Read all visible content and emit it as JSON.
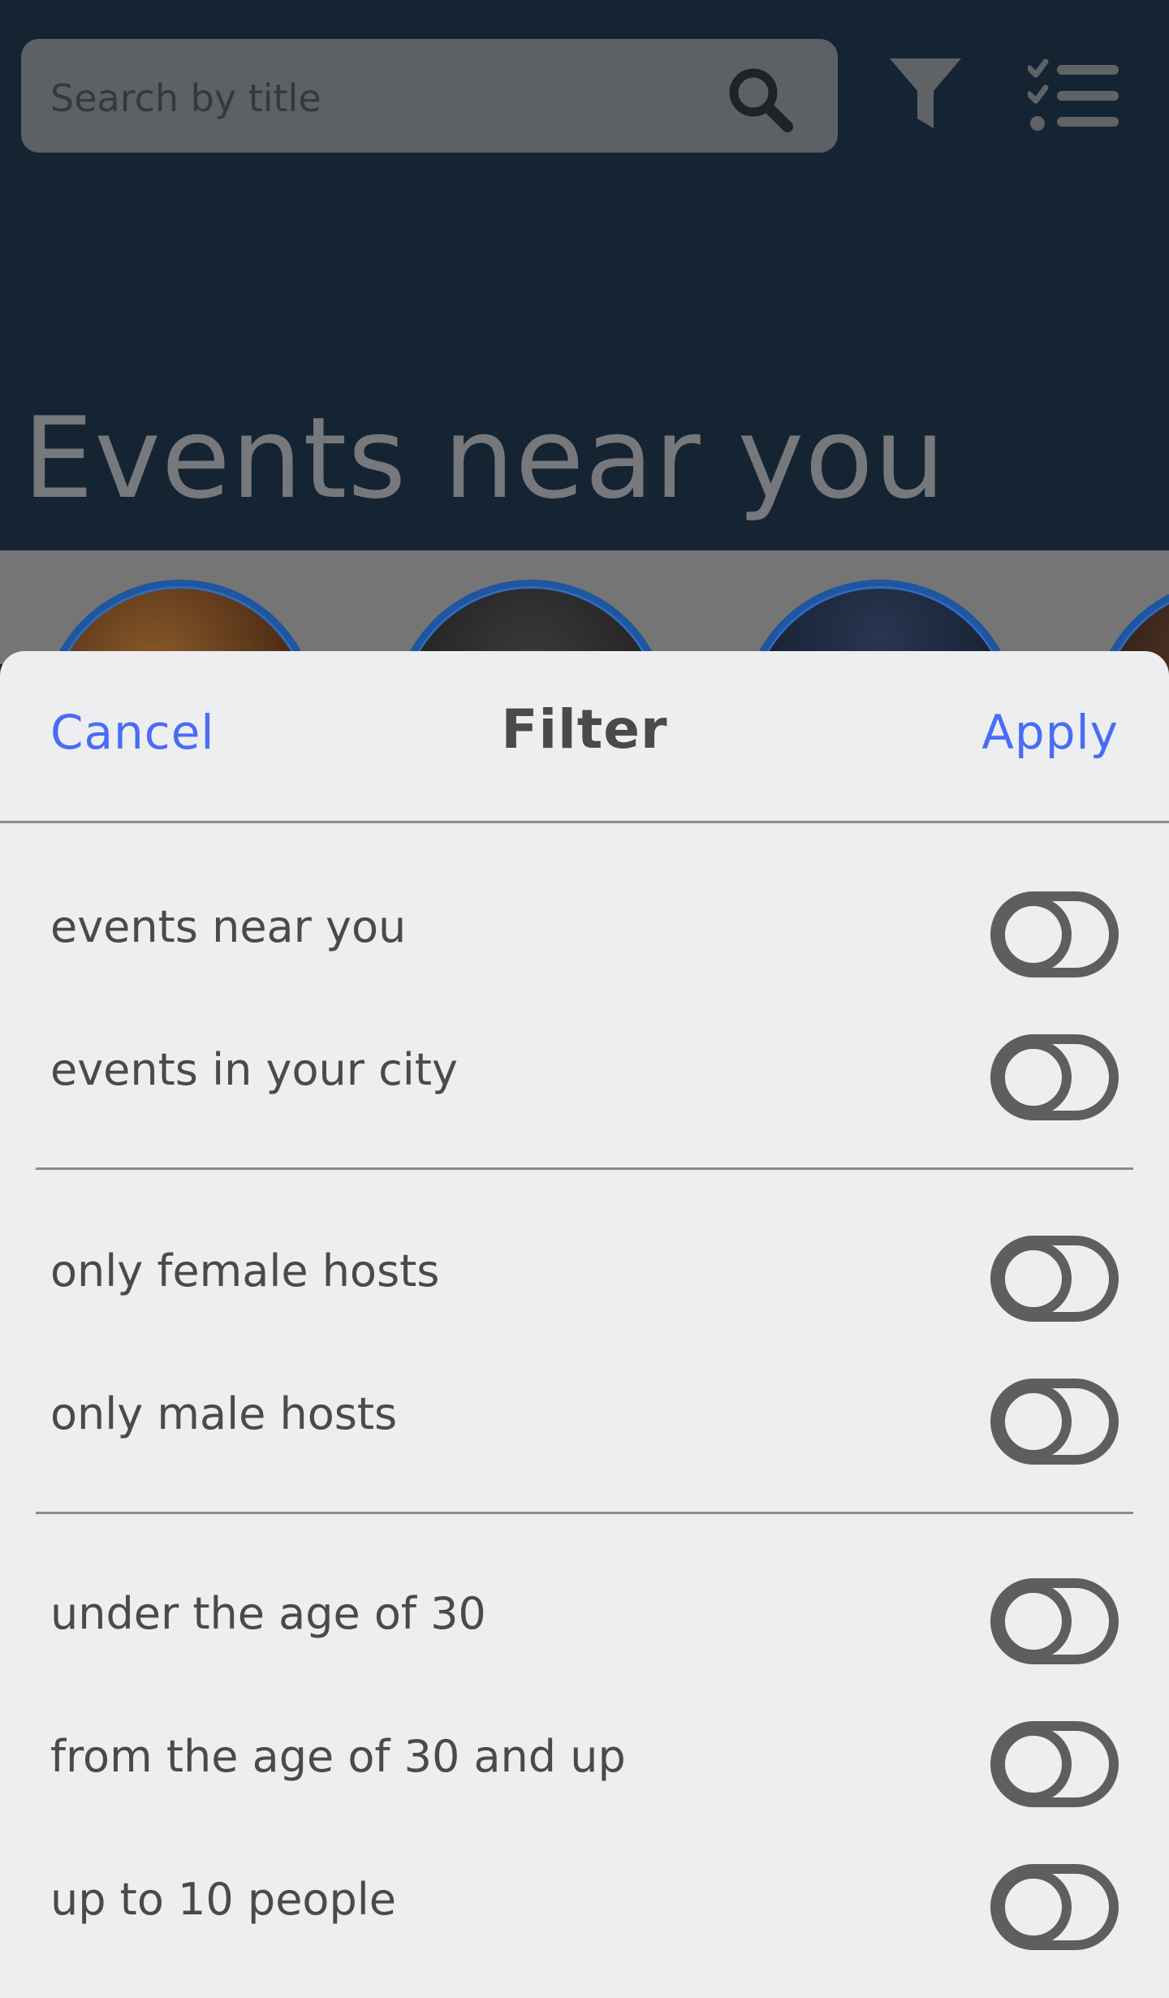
{
  "header": {
    "search_placeholder": "Search by title",
    "search_icon": "search-icon",
    "filter_icon": "filter-icon",
    "list_icon": "checklist-icon"
  },
  "main": {
    "section_title": "Events near you"
  },
  "filter_sheet": {
    "cancel_label": "Cancel",
    "title": "Filter",
    "apply_label": "Apply",
    "groups": [
      {
        "items": [
          {
            "label": "events near you",
            "on": false
          },
          {
            "label": "events in your city",
            "on": false
          }
        ]
      },
      {
        "items": [
          {
            "label": "only female hosts",
            "on": false
          },
          {
            "label": "only male hosts",
            "on": false
          }
        ]
      },
      {
        "items": [
          {
            "label": "under the age of 30",
            "on": false
          },
          {
            "label": "from the age of 30 and up",
            "on": false
          },
          {
            "label": "up to 10 people",
            "on": false
          }
        ]
      }
    ]
  },
  "colors": {
    "accent": "#4a6cf5",
    "background_dark": "#142433",
    "sheet_background": "#eceef0",
    "toggle_outline": "#5e5e5e",
    "text": "#4a4a4a"
  }
}
